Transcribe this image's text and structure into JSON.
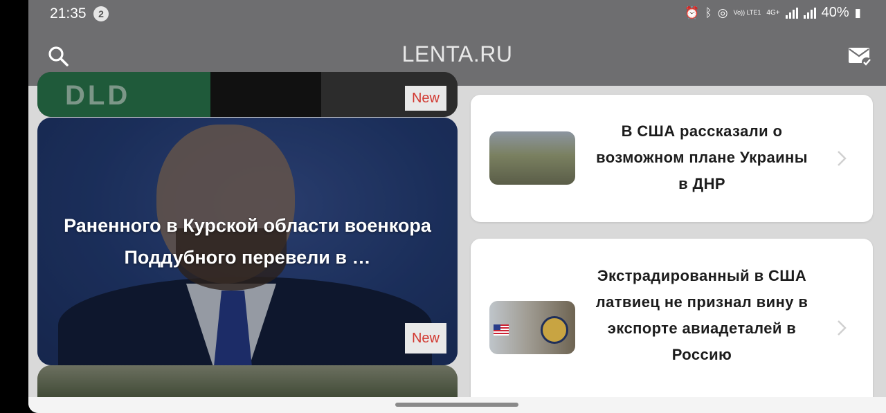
{
  "status_bar": {
    "time": "21:35",
    "notification_count": "2",
    "battery": "40%",
    "network_labels": [
      "Vo)) LTE1",
      "4G+"
    ]
  },
  "app_bar": {
    "title": "LENTA.RU",
    "search_icon": "search-icon",
    "inbox_icon": "mail-check-icon"
  },
  "left_cards": [
    {
      "badge": "New",
      "image_text": "DLD"
    },
    {
      "headline": "Раненного в Курской области военкора Поддубного перевели в …",
      "badge": "New"
    },
    {
      "image": "trees"
    }
  ],
  "right_cards": [
    {
      "title": "В США рассказали о возможном плане Украины в ДНР"
    },
    {
      "title": "Экстрадированный в США латвиец не признал вину в экспорте авиадеталей в Россию"
    }
  ],
  "colors": {
    "app_bar": "#6e6e70",
    "background": "#d9d9d9",
    "new_badge_text": "#d23a32"
  }
}
